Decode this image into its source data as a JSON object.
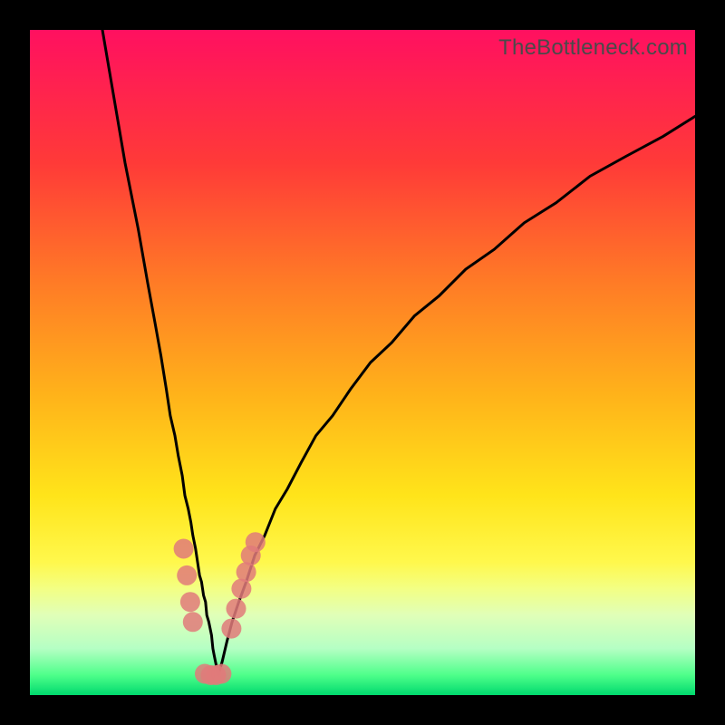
{
  "watermark": "TheBottleneck.com",
  "chart_data": {
    "type": "line",
    "title": "",
    "xlabel": "",
    "ylabel": "",
    "xlim": [
      0,
      100
    ],
    "ylim": [
      0,
      100
    ],
    "series": [
      {
        "name": "left-curve",
        "x": [
          10.9,
          14.3,
          16.3,
          17.7,
          18.8,
          19.7,
          20.5,
          21.1,
          21.8,
          22.3,
          22.9,
          23.3,
          23.8,
          24.2,
          24.5,
          24.9,
          25.2,
          25.5,
          25.8,
          26.1,
          26.4,
          26.6,
          26.9,
          27.1,
          27.3,
          27.5,
          27.7,
          27.9,
          28.1,
          28.3
        ],
        "y": [
          100,
          80,
          70,
          62,
          56,
          51,
          46,
          42,
          39,
          36,
          33,
          30,
          28,
          26,
          24,
          22,
          20,
          18,
          17,
          15,
          14,
          12,
          11,
          10,
          9,
          7,
          6,
          5,
          4,
          3
        ]
      },
      {
        "name": "right-curve",
        "x": [
          28.3,
          28.9,
          29.6,
          30.4,
          31.4,
          32.5,
          33.8,
          35.3,
          36.9,
          38.7,
          40.8,
          43.0,
          45.5,
          48.2,
          51.2,
          54.4,
          57.8,
          61.5,
          65.5,
          69.8,
          74.3,
          79.1,
          84.2,
          89.6,
          95.2,
          100.0
        ],
        "y": [
          3,
          5,
          8,
          11,
          14,
          17,
          21,
          24,
          28,
          31,
          35,
          39,
          42,
          46,
          50,
          53,
          57,
          60,
          64,
          67,
          71,
          74,
          78,
          81,
          84,
          87
        ]
      },
      {
        "name": "markers",
        "x": [
          23.1,
          23.6,
          24.1,
          24.5,
          26.3,
          27.2,
          28.0,
          28.8,
          30.3,
          31.0,
          31.8,
          32.5,
          33.2,
          33.9
        ],
        "y": [
          22.0,
          18.0,
          14.0,
          11.0,
          3.2,
          3.0,
          3.0,
          3.2,
          10.0,
          13.0,
          16.0,
          18.5,
          21.0,
          23.0
        ]
      }
    ],
    "marker_color": "#e07a7a",
    "curve_color": "#000000",
    "gradient_stops": [
      {
        "pos": 0,
        "color": "#ff1060"
      },
      {
        "pos": 20,
        "color": "#ff3a38"
      },
      {
        "pos": 38,
        "color": "#ff7b26"
      },
      {
        "pos": 55,
        "color": "#ffb31a"
      },
      {
        "pos": 70,
        "color": "#ffe41a"
      },
      {
        "pos": 80,
        "color": "#fff84c"
      },
      {
        "pos": 84,
        "color": "#f3ff84"
      },
      {
        "pos": 88,
        "color": "#e0ffb8"
      },
      {
        "pos": 93,
        "color": "#b5ffc4"
      },
      {
        "pos": 97,
        "color": "#4eff8a"
      },
      {
        "pos": 100,
        "color": "#00d96e"
      }
    ]
  }
}
